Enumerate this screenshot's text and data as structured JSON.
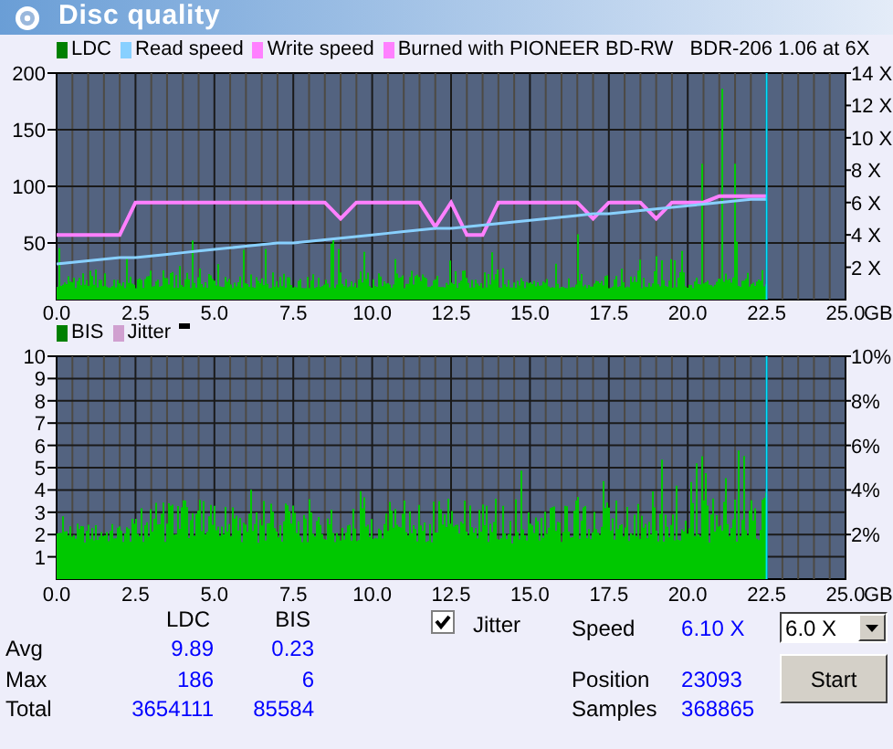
{
  "window": {
    "title": "Disc quality"
  },
  "ldc_chart": {
    "legend": [
      {
        "label": "LDC",
        "color": "#008000"
      },
      {
        "label": "Burned with PIONEER BD-RW   BDR-206 1.06 at 6X",
        "color": "#ff80ff"
      }
    ],
    "left_axis_labels": [
      "200",
      "150",
      "100",
      "50"
    ],
    "x_unit": "GB",
    "chart_data": {
      "type": "line",
      "xlim": [
        0,
        25
      ],
      "ylim": [
        0,
        14
      ],
      "grid": true,
      "x": [
        0,
        0.5,
        1,
        1.5,
        2,
        2.5,
        3,
        3.5,
        4,
        4.5,
        5,
        5.5,
        6,
        6.5,
        7,
        7.5,
        8,
        8.5,
        9,
        9.5,
        10,
        10.5,
        11,
        11.5,
        12,
        12.5,
        13,
        13.5,
        14,
        14.5,
        15,
        15.5,
        16,
        16.5,
        17,
        17.5,
        18,
        18.5,
        19,
        19.5,
        20,
        20.5,
        21,
        21.5,
        22,
        22.5
      ],
      "xticks": [
        {
          "value": 0,
          "label": "0.0"
        },
        {
          "value": 2.5,
          "label": "2.5"
        },
        {
          "value": 5,
          "label": "5.0"
        },
        {
          "value": 7.5,
          "label": "7.5"
        },
        {
          "value": 10,
          "label": "10.0"
        },
        {
          "value": 12.5,
          "label": "12.5"
        },
        {
          "value": 15,
          "label": "15.0"
        },
        {
          "value": 17.5,
          "label": "17.5"
        },
        {
          "value": 20,
          "label": "20.0"
        },
        {
          "value": 22.5,
          "label": "22.5"
        },
        {
          "value": 25,
          "label": "25.0"
        }
      ],
      "yticks": [
        {
          "value": 14,
          "label": "14 X"
        },
        {
          "value": 12,
          "label": "12 X"
        },
        {
          "value": 10,
          "label": "10 X"
        },
        {
          "value": 8,
          "label": "8 X"
        },
        {
          "value": 6,
          "label": "6 X"
        },
        {
          "value": 4,
          "label": "4 X"
        },
        {
          "value": 2,
          "label": "2 X"
        }
      ],
      "series": [
        {
          "name": "Read speed",
          "color": "#88d0ff",
          "values": [
            2.2,
            2.3,
            2.4,
            2.5,
            2.6,
            2.6,
            2.7,
            2.8,
            2.9,
            3.0,
            3.1,
            3.2,
            3.3,
            3.4,
            3.5,
            3.5,
            3.6,
            3.7,
            3.8,
            3.9,
            4.0,
            4.1,
            4.2,
            4.3,
            4.4,
            4.4,
            4.5,
            4.6,
            4.7,
            4.8,
            4.9,
            5.0,
            5.1,
            5.2,
            5.3,
            5.3,
            5.4,
            5.5,
            5.6,
            5.7,
            5.8,
            5.9,
            6.0,
            6.1,
            6.2,
            6.2
          ]
        },
        {
          "name": "Write speed",
          "color": "#ff80ff",
          "values": [
            4,
            4,
            4,
            4,
            4,
            6,
            6,
            6,
            6,
            6,
            6,
            6,
            6,
            6,
            6,
            6,
            6,
            6,
            5,
            6,
            6,
            6,
            6,
            6,
            4.5,
            6,
            4,
            4,
            6,
            6,
            6,
            6,
            6,
            6,
            5,
            6,
            6,
            6,
            5,
            6,
            6,
            6,
            6.4,
            6.4,
            6.4,
            6.4
          ]
        }
      ],
      "ref_lines": [
        {
          "axis": "x",
          "value": 22.5
        }
      ]
    }
  },
  "bis_chart": {
    "legend": [
      {
        "label": "BIS",
        "color": "#008000"
      },
      {
        "label": "Jitter",
        "color": "#d0a0d0"
      }
    ],
    "left_axis_labels": [
      "10",
      "9",
      "8",
      "7",
      "6",
      "5",
      "4",
      "3",
      "2",
      "1"
    ],
    "right_axis_labels": [
      "10%",
      "8%",
      "6%",
      "4%",
      "2%"
    ],
    "x_labels": [
      "0.0",
      "2.5",
      "5.0",
      "7.5",
      "10.0",
      "12.5",
      "15.0",
      "17.5",
      "20.0",
      "22.5",
      "25.0"
    ],
    "x_unit": "GB"
  },
  "stats": {
    "columns": [
      "LDC",
      "BIS"
    ],
    "rows": [
      {
        "label": "Avg",
        "values": [
          "9.89",
          "0.23"
        ]
      },
      {
        "label": "Max",
        "values": [
          "186",
          "6"
        ]
      },
      {
        "label": "Total",
        "values": [
          "3654111",
          "85584"
        ]
      }
    ]
  },
  "jitter": {
    "label": "Jitter",
    "checked": true
  },
  "info": [
    {
      "label": "Speed",
      "value": "6.10 X"
    },
    {
      "label": "Position",
      "value": "23093"
    },
    {
      "label": "Samples",
      "value": "368865"
    }
  ],
  "speed_select": {
    "value": "6.0 X"
  },
  "start_button": "Start"
}
